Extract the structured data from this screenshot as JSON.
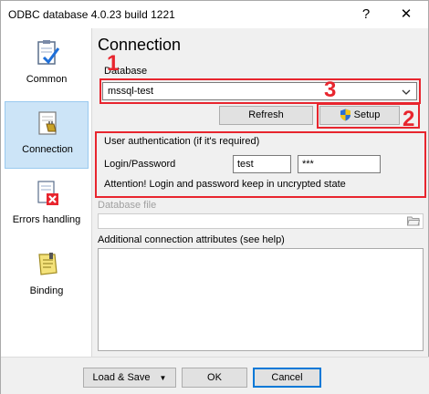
{
  "window": {
    "title": "ODBC database 4.0.23 build 1221",
    "help_glyph": "?",
    "close_glyph": "✕"
  },
  "sidebar": {
    "items": [
      {
        "label": "Common",
        "icon": "clipboard-check-icon"
      },
      {
        "label": "Connection",
        "icon": "connection-plug-icon"
      },
      {
        "label": "Errors handling",
        "icon": "error-document-icon"
      },
      {
        "label": "Binding",
        "icon": "binding-note-icon"
      }
    ]
  },
  "main": {
    "heading": "Connection",
    "database_label": "Database",
    "database_value": "mssql-test",
    "refresh_label": "Refresh",
    "setup_label": "Setup",
    "auth_title": "User authentication (if it's required)",
    "login_password_label": "Login/Password",
    "login_value": "test",
    "password_value": "***",
    "attention_text": "Attention! Login and password keep in uncrypted state",
    "database_file_label": "Database file",
    "attributes_label": "Additional connection attributes (see help)"
  },
  "annotations": {
    "n1": "1",
    "n2": "2",
    "n3": "3",
    "color": "#e8252e"
  },
  "footer": {
    "load_save_label": "Load & Save",
    "ok_label": "OK",
    "cancel_label": "Cancel"
  }
}
